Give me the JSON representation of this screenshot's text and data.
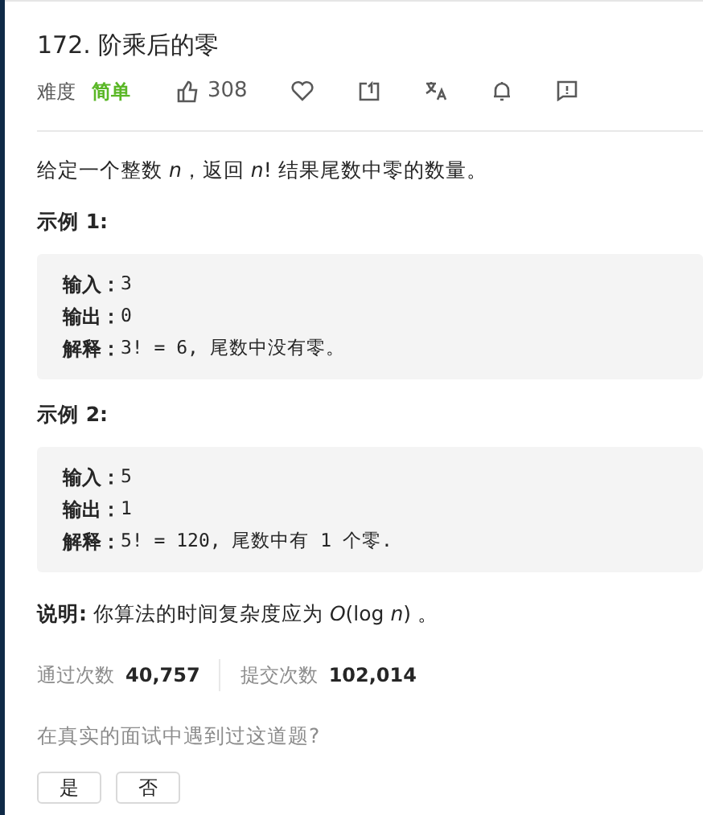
{
  "title": "172. 阶乘后的零",
  "meta": {
    "difficulty_label": "难度",
    "difficulty": "简单",
    "likes": "308"
  },
  "description": "给定一个整数 *n*，返回 *n*! 结果尾数中零的数量。",
  "examples": [
    {
      "heading": "示例 1:",
      "lines": [
        {
          "label": "输入：",
          "value": "3"
        },
        {
          "label": "输出：",
          "value": "0"
        },
        {
          "label": "解释：",
          "value": "3! = 6, 尾数中没有零。"
        }
      ]
    },
    {
      "heading": "示例 2:",
      "lines": [
        {
          "label": "输入：",
          "value": "5"
        },
        {
          "label": "输出：",
          "value": "1"
        },
        {
          "label": "解释：",
          "value": "5! = 120, 尾数中有 1 个零."
        }
      ]
    }
  ],
  "note": "**说明:** 你算法的时间复杂度应为 *O*(log *n*) 。",
  "stats": [
    {
      "label": "通过次数",
      "value": "40,757"
    },
    {
      "label": "提交次数",
      "value": "102,014"
    }
  ],
  "question": "在真实的面试中遇到过这道题?",
  "buttons": [
    "是",
    "否"
  ]
}
